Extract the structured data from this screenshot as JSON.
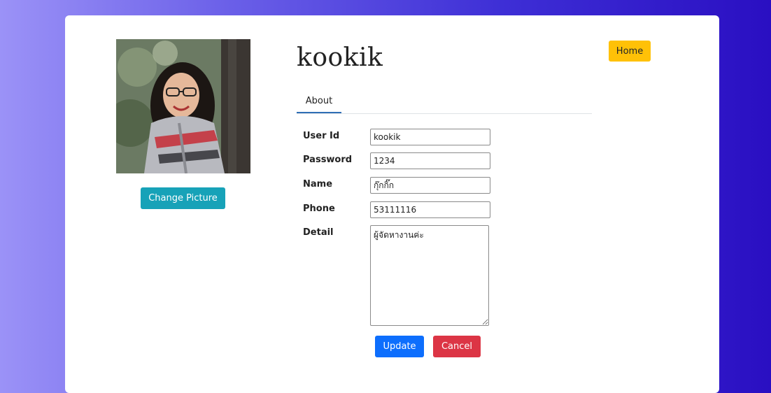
{
  "profile": {
    "title": "kookik",
    "change_picture_label": "Change Picture",
    "home_label": "Home"
  },
  "tabs": [
    {
      "label": "About",
      "active": true
    }
  ],
  "form": {
    "user_id": {
      "label": "User Id",
      "value": "kookik"
    },
    "password": {
      "label": "Password",
      "value": "1234"
    },
    "name": {
      "label": "Name",
      "value": "กุ๊กกิ๊ก"
    },
    "phone": {
      "label": "Phone",
      "value": "53111116"
    },
    "detail": {
      "label": "Detail",
      "value": "ผู้จัดหางานค่ะ"
    }
  },
  "actions": {
    "update_label": "Update",
    "cancel_label": "Cancel"
  },
  "colors": {
    "change_picture": "#17a2b8",
    "home": "#ffc107",
    "update": "#0d6efd",
    "cancel": "#dc3545",
    "tab_active": "#2f6fb5"
  }
}
